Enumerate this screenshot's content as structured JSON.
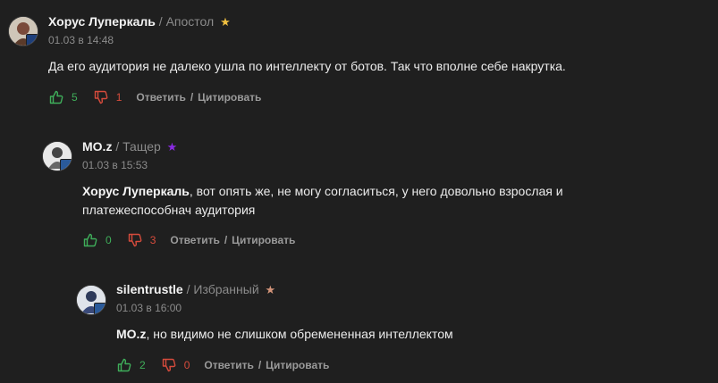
{
  "colors": {
    "background": "#1f1f1f",
    "like": "#3fae5a",
    "dislike": "#d64b3c",
    "meta": "#8b8b8b",
    "star_gold": "#f0c040",
    "star_purple": "#8a2be2",
    "star_bronze": "#d4957a"
  },
  "comments": [
    {
      "author": "Хорус Луперкаль",
      "role": "Апостол",
      "date": "01.03 в 14:48",
      "text": "Да его аудитория не далеко ушла по интеллекту от ботов. Так что вполне себе накрутка.",
      "likes": "5",
      "dislikes": "1",
      "star_icon": "gold-star-icon"
    },
    {
      "author": "MO.z",
      "role": "Тащер",
      "date": "01.03 в 15:53",
      "mention": "Хорус Луперкаль",
      "text": ", вот опять же, не могу согласиться, у него довольно взрослая и платежеспособнач аудитория",
      "likes": "0",
      "dislikes": "3",
      "star_icon": "purple-star-icon"
    },
    {
      "author": "silentrustle",
      "role": "Избранный",
      "date": "01.03 в 16:00",
      "mention": "MO.z",
      "text": ", но видимо не слишком обремененная интеллектом",
      "likes": "2",
      "dislikes": "0",
      "star_icon": "bronze-star-icon"
    }
  ],
  "actions": {
    "reply": "Ответить",
    "quote": "Цитировать",
    "separator": "/"
  },
  "role_separator": "/"
}
